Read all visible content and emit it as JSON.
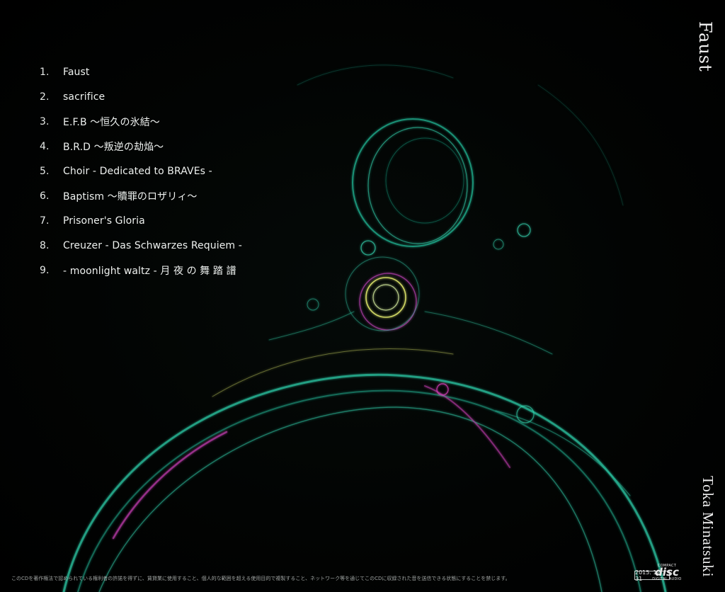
{
  "album": {
    "title": "Faust",
    "artist": "Toka Minatsuki"
  },
  "tracks": [
    {
      "number": "1.",
      "title": "Faust"
    },
    {
      "number": "2.",
      "title": "sacrifice"
    },
    {
      "number": "3.",
      "title": "E.F.B ～恒久の氷結～"
    },
    {
      "number": "4.",
      "title": "B.R.D ～叛逆の劫焔～"
    },
    {
      "number": "5.",
      "title": "Choir - Dedicated to BRAVEs -"
    },
    {
      "number": "6.",
      "title": "Baptism ～贖罪のロザリィ～"
    },
    {
      "number": "7.",
      "title": "Prisoner's Gloria"
    },
    {
      "number": "8.",
      "title": "Creuzer - Das Schwarzes Requiem -"
    },
    {
      "number": "9.",
      "title": "- moonlight waltz - 月 夜 の 舞 踏 譜"
    }
  ],
  "footer": {
    "copyright": "このCDを著作権法で認められている権利者の許諾を得ずに、賃貸業に使用すること、個人的な範囲を超える使用目的で複製すること、ネットワーク等を通じてこのCDに収録された音を送信できる状態にすることを禁じます。",
    "release_date": "2015. 12. 31",
    "logo_top": "COMPACT",
    "logo_main": "disc",
    "logo_bottom": "DIGITAL AUDIO"
  },
  "colors": {
    "background": "#000000",
    "fractal_primary": "#2fd6b0",
    "fractal_accent": "#e040c0",
    "fractal_highlight": "#e8f070"
  }
}
